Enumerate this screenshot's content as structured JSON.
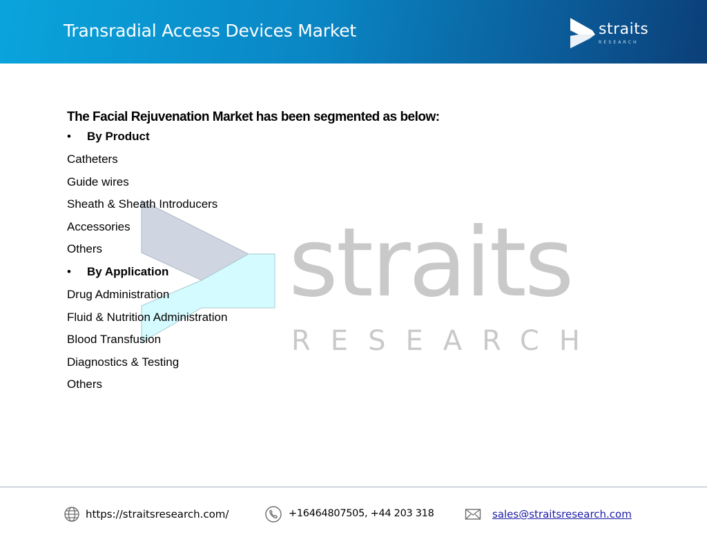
{
  "header": {
    "title": "Transradial Access Devices Market",
    "brand_word": "straits",
    "brand_sub": "RESEARCH",
    "background_colors": [
      "#0aa4dc",
      "#0b3f78"
    ]
  },
  "watermark": {
    "word": "straits",
    "sub": "RESEARCH"
  },
  "content": {
    "heading": "The Facial Rejuvenation Market has been segmented as below:",
    "bullet_symbol": "•",
    "sections": [
      {
        "label": "By Product",
        "items": [
          "Catheters",
          "Guide wires",
          "Sheath & Sheath Introducers",
          "Accessories",
          "Others"
        ]
      },
      {
        "label": "By Application",
        "items": [
          "Drug Administration",
          "Fluid & Nutrition Administration",
          "Blood Transfusion",
          "Diagnostics & Testing",
          "Others"
        ]
      }
    ]
  },
  "footer": {
    "website": {
      "icon": "globe-icon",
      "text": "https://straitsresearch.com/"
    },
    "phone": {
      "icon": "phone-icon",
      "text": "+16464807505, +44 203 318"
    },
    "email": {
      "icon": "envelope-icon",
      "text": "sales@straitsresearch.com",
      "color": "#1a1aa6"
    }
  }
}
